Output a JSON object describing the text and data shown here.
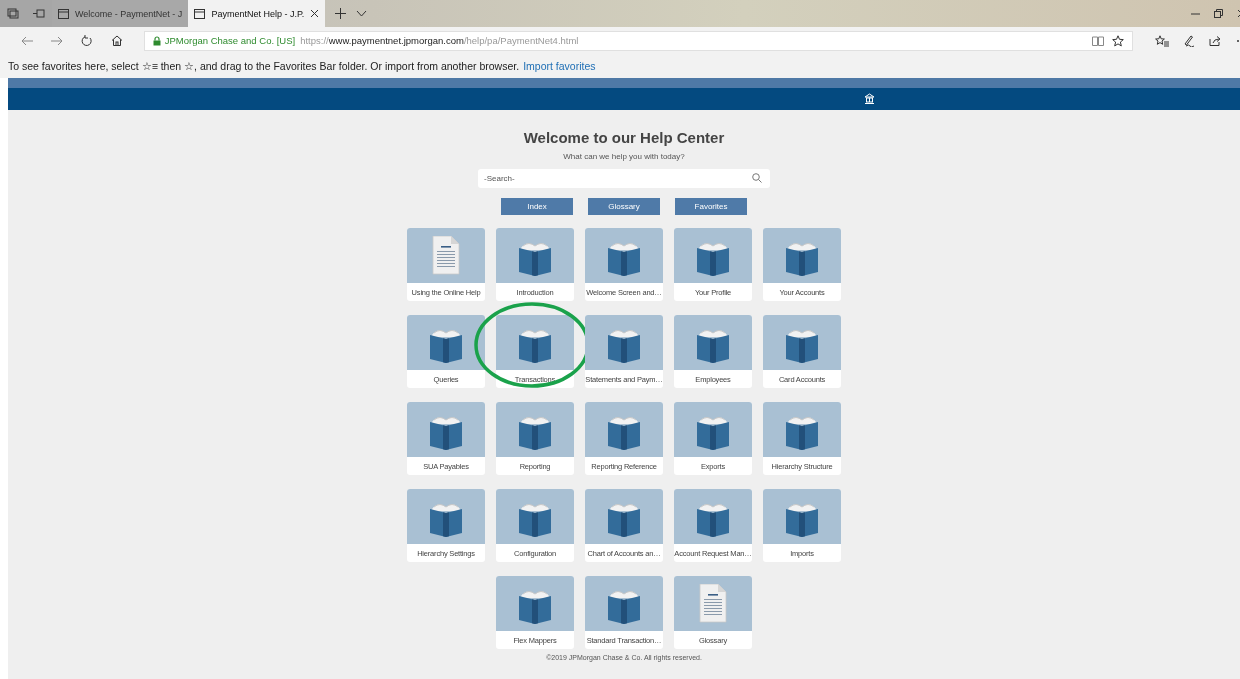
{
  "browser": {
    "tabs": [
      {
        "title": "Welcome - PaymentNet - J",
        "selected": false
      },
      {
        "title": "PaymentNet Help - J.P.",
        "selected": true
      }
    ],
    "address_bar": {
      "site_identity": "JPMorgan Chase and Co. [US]",
      "url_scheme": "https://",
      "url_host": "www.paymentnet.jpmorgan.com",
      "url_path": "/help/pa/PaymentNet4.html"
    },
    "favorites_bar": {
      "message": "To see favorites here, select ☆≡ then ☆, and drag to the Favorites Bar folder. Or import from another browser.",
      "link": "Import favorites"
    }
  },
  "page": {
    "title": "Welcome to our Help Center",
    "subtitle": "What can we help you with today?",
    "search": {
      "placeholder": "-Search-"
    },
    "buttons": [
      "Index",
      "Glossary",
      "Favorites"
    ],
    "tiles": [
      {
        "label": "Using the Online Help",
        "kind": "document",
        "highlighted": false
      },
      {
        "label": "Introduction",
        "kind": "book",
        "highlighted": false
      },
      {
        "label": "Welcome Screen and…",
        "kind": "book",
        "highlighted": false
      },
      {
        "label": "Your Profile",
        "kind": "book",
        "highlighted": false
      },
      {
        "label": "Your Accounts",
        "kind": "book",
        "highlighted": false
      },
      {
        "label": "Queries",
        "kind": "book",
        "highlighted": false
      },
      {
        "label": "Transactions",
        "kind": "book",
        "highlighted": true
      },
      {
        "label": "Statements and Paym…",
        "kind": "book",
        "highlighted": false
      },
      {
        "label": "Employees",
        "kind": "book",
        "highlighted": false
      },
      {
        "label": "Card Accounts",
        "kind": "book",
        "highlighted": false
      },
      {
        "label": "SUA Payables",
        "kind": "book",
        "highlighted": false
      },
      {
        "label": "Reporting",
        "kind": "book",
        "highlighted": false
      },
      {
        "label": "Reporting Reference",
        "kind": "book",
        "highlighted": false
      },
      {
        "label": "Exports",
        "kind": "book",
        "highlighted": false
      },
      {
        "label": "Hierarchy Structure",
        "kind": "book",
        "highlighted": false
      },
      {
        "label": "Hierarchy Settings",
        "kind": "book",
        "highlighted": false
      },
      {
        "label": "Configuration",
        "kind": "book",
        "highlighted": false
      },
      {
        "label": "Chart of Accounts an…",
        "kind": "book",
        "highlighted": false
      },
      {
        "label": "Account Request Man…",
        "kind": "book",
        "highlighted": false
      },
      {
        "label": "Imports",
        "kind": "book",
        "highlighted": false
      },
      {
        "label": "Flex Mappers",
        "kind": "book",
        "highlighted": false
      },
      {
        "label": "Standard Transaction…",
        "kind": "book",
        "highlighted": false
      },
      {
        "label": "Glossary",
        "kind": "document",
        "highlighted": false
      }
    ],
    "footer": "©2019 JPMorgan Chase & Co. All rights reserved."
  }
}
